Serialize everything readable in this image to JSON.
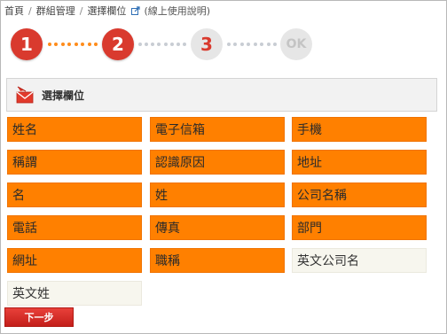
{
  "breadcrumb": {
    "items": [
      "首頁",
      "群組管理",
      "選擇欄位"
    ],
    "separator": "/",
    "help_link": "(線上使用說明)"
  },
  "steps": [
    {
      "label": "1",
      "state": "done"
    },
    {
      "label": "2",
      "state": "current"
    },
    {
      "label": "3",
      "state": "pending"
    },
    {
      "label": "OK",
      "state": "final"
    }
  ],
  "section": {
    "title": "選擇欄位",
    "icon": "envelope-arrow-icon"
  },
  "fields": [
    {
      "label": "姓名",
      "selected": true
    },
    {
      "label": "電子信箱",
      "selected": true
    },
    {
      "label": "手機",
      "selected": true
    },
    {
      "label": "稱謂",
      "selected": true
    },
    {
      "label": "認識原因",
      "selected": true
    },
    {
      "label": "地址",
      "selected": true
    },
    {
      "label": "名",
      "selected": true
    },
    {
      "label": "姓",
      "selected": true
    },
    {
      "label": "公司名稱",
      "selected": true
    },
    {
      "label": "電話",
      "selected": true
    },
    {
      "label": "傳真",
      "selected": true
    },
    {
      "label": "部門",
      "selected": true
    },
    {
      "label": "網址",
      "selected": true
    },
    {
      "label": "職稱",
      "selected": true
    },
    {
      "label": "英文公司名",
      "selected": false
    },
    {
      "label": "英文姓",
      "selected": false
    }
  ],
  "next_button": {
    "label": "下一步"
  },
  "colors": {
    "step_active": "#d93a2e",
    "step_inactive": "#e6e6e6",
    "field_selected": "#ff8000",
    "field_unselected": "#f7f6ee",
    "button": "#d42a24"
  }
}
